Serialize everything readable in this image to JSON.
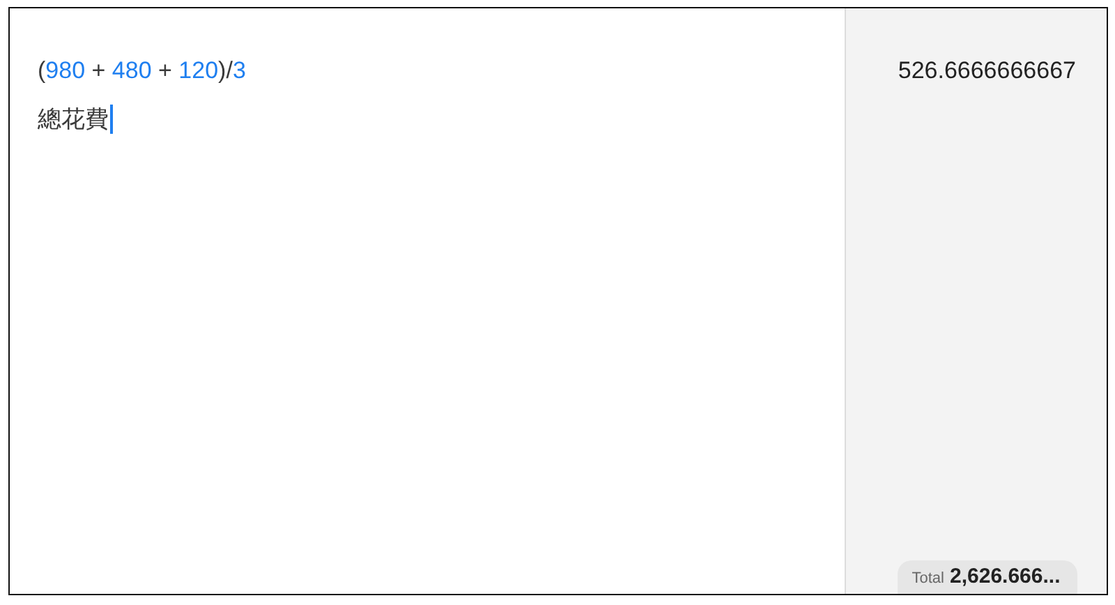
{
  "lines": [
    {
      "tokens": [
        {
          "text": "(",
          "kind": "text"
        },
        {
          "text": "980",
          "kind": "number"
        },
        {
          "text": " + ",
          "kind": "text"
        },
        {
          "text": "480",
          "kind": "number"
        },
        {
          "text": " + ",
          "kind": "text"
        },
        {
          "text": "120",
          "kind": "number"
        },
        {
          "text": ")/",
          "kind": "text"
        },
        {
          "text": "3",
          "kind": "number"
        }
      ],
      "result": "526.6666666667",
      "cursor": false
    },
    {
      "tokens": [
        {
          "text": "總花費",
          "kind": "text"
        }
      ],
      "cursor": true
    }
  ],
  "total": {
    "label": "Total",
    "value": "2,626.666..."
  }
}
